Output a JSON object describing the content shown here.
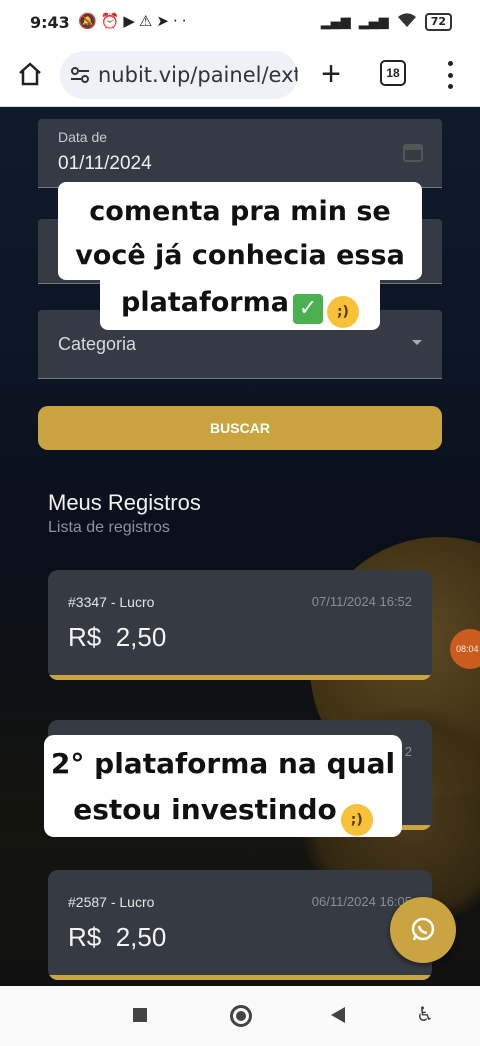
{
  "status_bar": {
    "time": "9:43",
    "left_icons": [
      "muted-bell-icon",
      "alarm-icon",
      "youtube-icon",
      "warning-icon",
      "location-arrow-icon",
      "more-dots-icon"
    ],
    "battery": "72"
  },
  "browser": {
    "url": "nubit.vip/painel/ext",
    "tab_count": "18"
  },
  "form": {
    "date_from_label": "Data de",
    "date_from_value": "01/11/2024",
    "category_label": "Categoria",
    "search_button": "BUSCAR"
  },
  "records": {
    "title": "Meus Registros",
    "subtitle": "Lista de registros",
    "items": [
      {
        "id": "#3347 - Lucro",
        "date": "07/11/2024 16:52",
        "currency": "R$",
        "amount": "2,50"
      },
      {
        "id": "",
        "date": "2",
        "currency": "",
        "amount": ""
      },
      {
        "id": "#2587 - Lucro",
        "date": "06/11/2024 16:05",
        "currency": "R$",
        "amount": "2,50"
      }
    ]
  },
  "badge": {
    "text": "08:04"
  },
  "captions": {
    "top_line1": "comenta pra min se",
    "top_line2": "você já conhecia essa",
    "top_line3": "plataforma",
    "bottom_line1": "2° plataforma na qual",
    "bottom_line2": "estou investindo"
  },
  "colors": {
    "accent_gold": "#c9a441",
    "card_bg": "#363a42",
    "field_bg": "#353a45"
  }
}
